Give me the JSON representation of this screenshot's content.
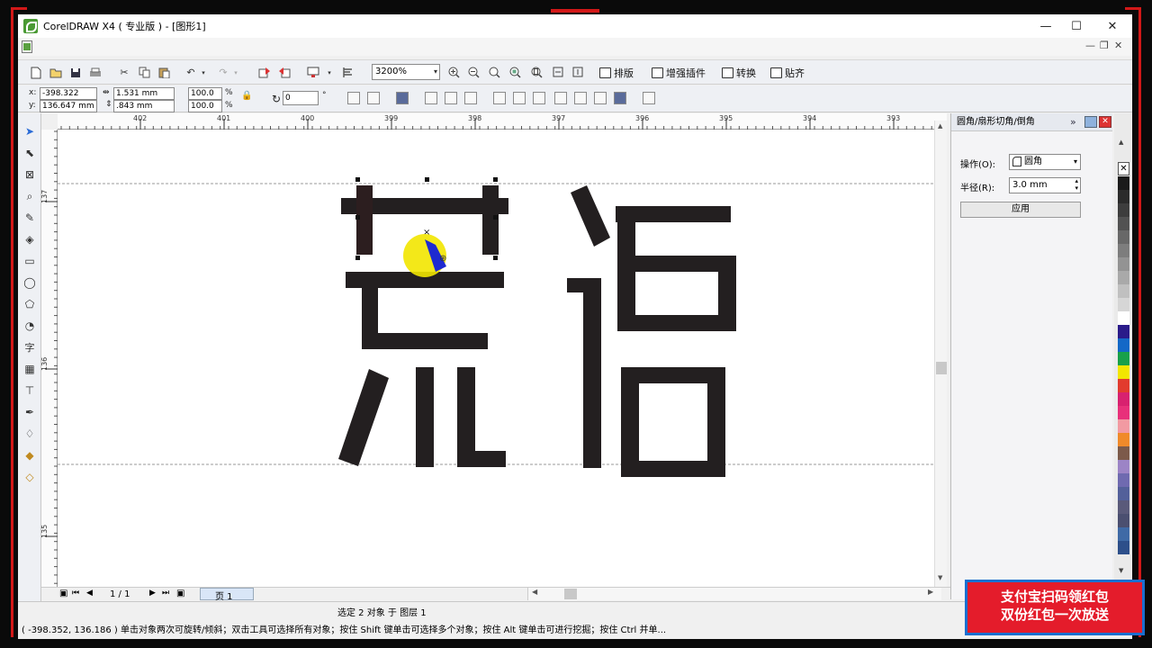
{
  "window": {
    "title": "CorelDRAW X4 ( 专业版 ) - [图形1]",
    "controls": {
      "minimize": "—",
      "maximize": "☐",
      "close": "✕"
    },
    "doc_controls": {
      "minimize": "—",
      "restore": "❐",
      "close": "✕"
    }
  },
  "toolbar": {
    "zoom_value": "3200%",
    "plugins": [
      {
        "label": "排版",
        "icon": "layout-icon"
      },
      {
        "label": "增强插件",
        "icon": "plugin-icon"
      },
      {
        "label": "转换",
        "icon": "convert-icon"
      },
      {
        "label": "贴齐",
        "icon": "snap-icon"
      }
    ]
  },
  "property_bar": {
    "x_label": "x:",
    "x_value": "-398.322 mm",
    "y_label": "y:",
    "y_value": "136.647 mm",
    "width_value": "1.531 mm",
    "height_value": ".843 mm",
    "scale_x": "100.0",
    "scale_y": "100.0",
    "percent": "%",
    "rotation_value": "0",
    "degree": "°"
  },
  "rulers": {
    "horizontal_ticks": [
      "402",
      "401",
      "400",
      "399",
      "398",
      "397",
      "396",
      "395",
      "394",
      "393"
    ],
    "vertical_ticks": [
      "137",
      "136",
      "135"
    ]
  },
  "canvas": {
    "artwork_text": "荒语",
    "selection_center": "×"
  },
  "docker": {
    "title": "圆角/扇形切角/倒角",
    "operation_label": "操作(O):",
    "operation_value": "圆角",
    "radius_label": "半径(R):",
    "radius_value": "3.0 mm",
    "apply_button": "应用"
  },
  "page_nav": {
    "counter": "1 / 1",
    "page_tab": "页 1"
  },
  "status": {
    "selection_info": "选定 2 对象 于 图层 1",
    "coords_hint": "( -398.352, 136.186 )   单击对象两次可旋转/倾斜；双击工具可选择所有对象；按住 Shift 键单击可选择多个对象；按住 Alt 键单击可进行挖掘；按住 Ctrl 并单..."
  },
  "ad": {
    "line1": "支付宝扫码领红包",
    "line2": "双份红包一次放送"
  },
  "colors": {
    "accent_border": "#d21818",
    "selection_dot": "#f2e600",
    "selected_shape": "#1e2ad0",
    "ad_background": "#e41c2b",
    "ad_border": "#1a6fd0"
  }
}
